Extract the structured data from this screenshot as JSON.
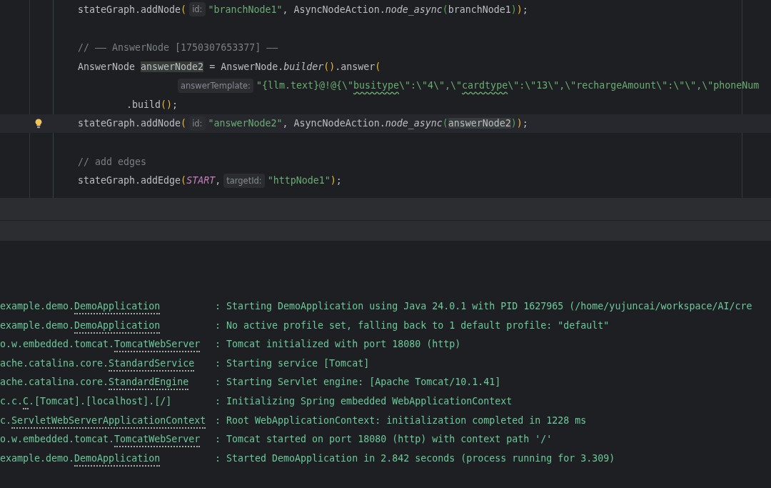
{
  "editor": {
    "lines": [
      {
        "kind": "statement",
        "current": false,
        "parts": [
          {
            "kind": "code",
            "tokens": [
              {
                "text": "stateGraph.addNode",
                "kind": "plain"
              },
              {
                "text": "(",
                "kind": "paren1"
              }
            ]
          },
          {
            "kind": "hint",
            "text": "id:"
          },
          {
            "kind": "code",
            "tokens": [
              {
                "text": "\"branchNode1\"",
                "kind": "string"
              },
              {
                "text": ", AsyncNodeAction.",
                "kind": "plain"
              },
              {
                "text": "node_async",
                "kind": "method"
              },
              {
                "text": "(",
                "kind": "paren2"
              },
              {
                "text": "branchNode1",
                "kind": "plain"
              },
              {
                "text": ")",
                "kind": "paren2"
              },
              {
                "text": ")",
                "kind": "paren1"
              },
              {
                "text": ";",
                "kind": "plain"
              }
            ]
          }
        ]
      },
      {
        "kind": "blank",
        "current": false
      },
      {
        "kind": "statement",
        "current": false,
        "parts": [
          {
            "kind": "code",
            "tokens": [
              {
                "text": "// —— AnswerNode [1750307653377] ——",
                "kind": "comment"
              }
            ]
          }
        ]
      },
      {
        "kind": "statement",
        "current": false,
        "parts": [
          {
            "kind": "code",
            "tokens": [
              {
                "text": "AnswerNode ",
                "kind": "plain"
              },
              {
                "text": "answerNode2",
                "kind": "highlight"
              },
              {
                "text": " = AnswerNode.",
                "kind": "plain"
              },
              {
                "text": "builder",
                "kind": "method"
              },
              {
                "text": "()",
                "kind": "paren1"
              },
              {
                "text": ".answer",
                "kind": "plain"
              },
              {
                "text": "(",
                "kind": "paren1"
              }
            ]
          }
        ]
      },
      {
        "kind": "argument",
        "current": false,
        "parts": [
          {
            "kind": "hint",
            "text": "answerTemplate:"
          },
          {
            "kind": "code",
            "tokens": [
              {
                "text": "\"{llm.text}@!@{\\\"",
                "kind": "string"
              },
              {
                "text": "busitype",
                "kind": "typo"
              },
              {
                "text": "\\\":\\\"4\\\",\\\"",
                "kind": "string"
              },
              {
                "text": "cardtype",
                "kind": "typo"
              },
              {
                "text": "\\\":\\\"13\\\",\\\"rechargeAmount\\\":\\\"\\\",\\\"phoneNum",
                "kind": "string"
              }
            ]
          }
        ]
      },
      {
        "kind": "chained",
        "current": false,
        "parts": [
          {
            "kind": "code",
            "tokens": [
              {
                "text": ".build",
                "kind": "plain"
              },
              {
                "text": "()",
                "kind": "paren1"
              },
              {
                "text": ";",
                "kind": "plain"
              }
            ]
          }
        ]
      },
      {
        "kind": "statement",
        "current": true,
        "parts": [
          {
            "kind": "code",
            "tokens": [
              {
                "text": "stateGraph.addNode",
                "kind": "plain"
              },
              {
                "text": "(",
                "kind": "paren1"
              }
            ]
          },
          {
            "kind": "hint",
            "text": "id:"
          },
          {
            "kind": "code",
            "tokens": [
              {
                "text": "\"answerNode2\"",
                "kind": "string"
              },
              {
                "text": ", AsyncNodeAction.",
                "kind": "plain"
              },
              {
                "text": "node_async",
                "kind": "method"
              },
              {
                "text": "(",
                "kind": "paren2"
              },
              {
                "text": "answerNode2",
                "kind": "highlight"
              },
              {
                "text": ")",
                "kind": "paren2"
              },
              {
                "text": ")",
                "kind": "paren1"
              },
              {
                "text": ";",
                "kind": "plain"
              }
            ]
          }
        ]
      },
      {
        "kind": "blank",
        "current": false
      },
      {
        "kind": "statement",
        "current": false,
        "parts": [
          {
            "kind": "code",
            "tokens": [
              {
                "text": "// add edges",
                "kind": "comment"
              }
            ]
          }
        ]
      },
      {
        "kind": "statement",
        "current": false,
        "parts": [
          {
            "kind": "code",
            "tokens": [
              {
                "text": "stateGraph.addEdge",
                "kind": "plain"
              },
              {
                "text": "(",
                "kind": "paren1"
              },
              {
                "text": "START",
                "kind": "constant"
              },
              {
                "text": ",",
                "kind": "plain"
              }
            ]
          },
          {
            "kind": "hint",
            "text": "targetId:"
          },
          {
            "kind": "code",
            "tokens": [
              {
                "text": "\"httpNode1\"",
                "kind": "string"
              },
              {
                "text": ")",
                "kind": "paren1"
              },
              {
                "text": ";",
                "kind": "plain"
              }
            ]
          }
        ]
      }
    ]
  },
  "console": {
    "lines": [
      {
        "logger": [
          {
            "text": "example.demo.",
            "link": false
          },
          {
            "text": "DemoApplication",
            "link": true
          }
        ],
        "message": ": Starting DemoApplication using Java 24.0.1 with PID 1627965 (/home/yujuncai/workspace/AI/cre"
      },
      {
        "logger": [
          {
            "text": "example.demo.",
            "link": false
          },
          {
            "text": "DemoApplication",
            "link": true
          }
        ],
        "message": ": No active profile set, falling back to 1 default profile: \"default\""
      },
      {
        "logger": [
          {
            "text": "o.w.embedded.tomcat.",
            "link": false
          },
          {
            "text": "TomcatWebServer",
            "link": true
          }
        ],
        "message": ": Tomcat initialized with port 18080 (http)"
      },
      {
        "logger": [
          {
            "text": "ache.catalina.core.",
            "link": false
          },
          {
            "text": "StandardService",
            "link": true
          }
        ],
        "message": ": Starting service [Tomcat]"
      },
      {
        "logger": [
          {
            "text": "ache.catalina.core.",
            "link": false
          },
          {
            "text": "StandardEngine",
            "link": true
          }
        ],
        "message": ": Starting Servlet engine: [Apache Tomcat/10.1.41]"
      },
      {
        "logger": [
          {
            "text": "c.c.",
            "link": false
          },
          {
            "text": "C",
            "link": true
          },
          {
            "text": ".[Tomcat].[localhost].[/]",
            "link": false
          }
        ],
        "message": ": Initializing Spring embedded WebApplicationContext"
      },
      {
        "logger": [
          {
            "text": "c.",
            "link": false
          },
          {
            "text": "ServletWebServerApplicationContext",
            "link": true
          }
        ],
        "message": ": Root WebApplicationContext: initialization completed in 1228 ms"
      },
      {
        "logger": [
          {
            "text": "o.w.embedded.tomcat.",
            "link": false
          },
          {
            "text": "TomcatWebServer",
            "link": true
          }
        ],
        "message": ": Tomcat started on port 18080 (http) with context path '/'"
      },
      {
        "logger": [
          {
            "text": "example.demo.",
            "link": false
          },
          {
            "text": "DemoApplication",
            "link": true
          }
        ],
        "message": ": Started DemoApplication in 2.842 seconds (process running for 3.309)"
      }
    ]
  }
}
